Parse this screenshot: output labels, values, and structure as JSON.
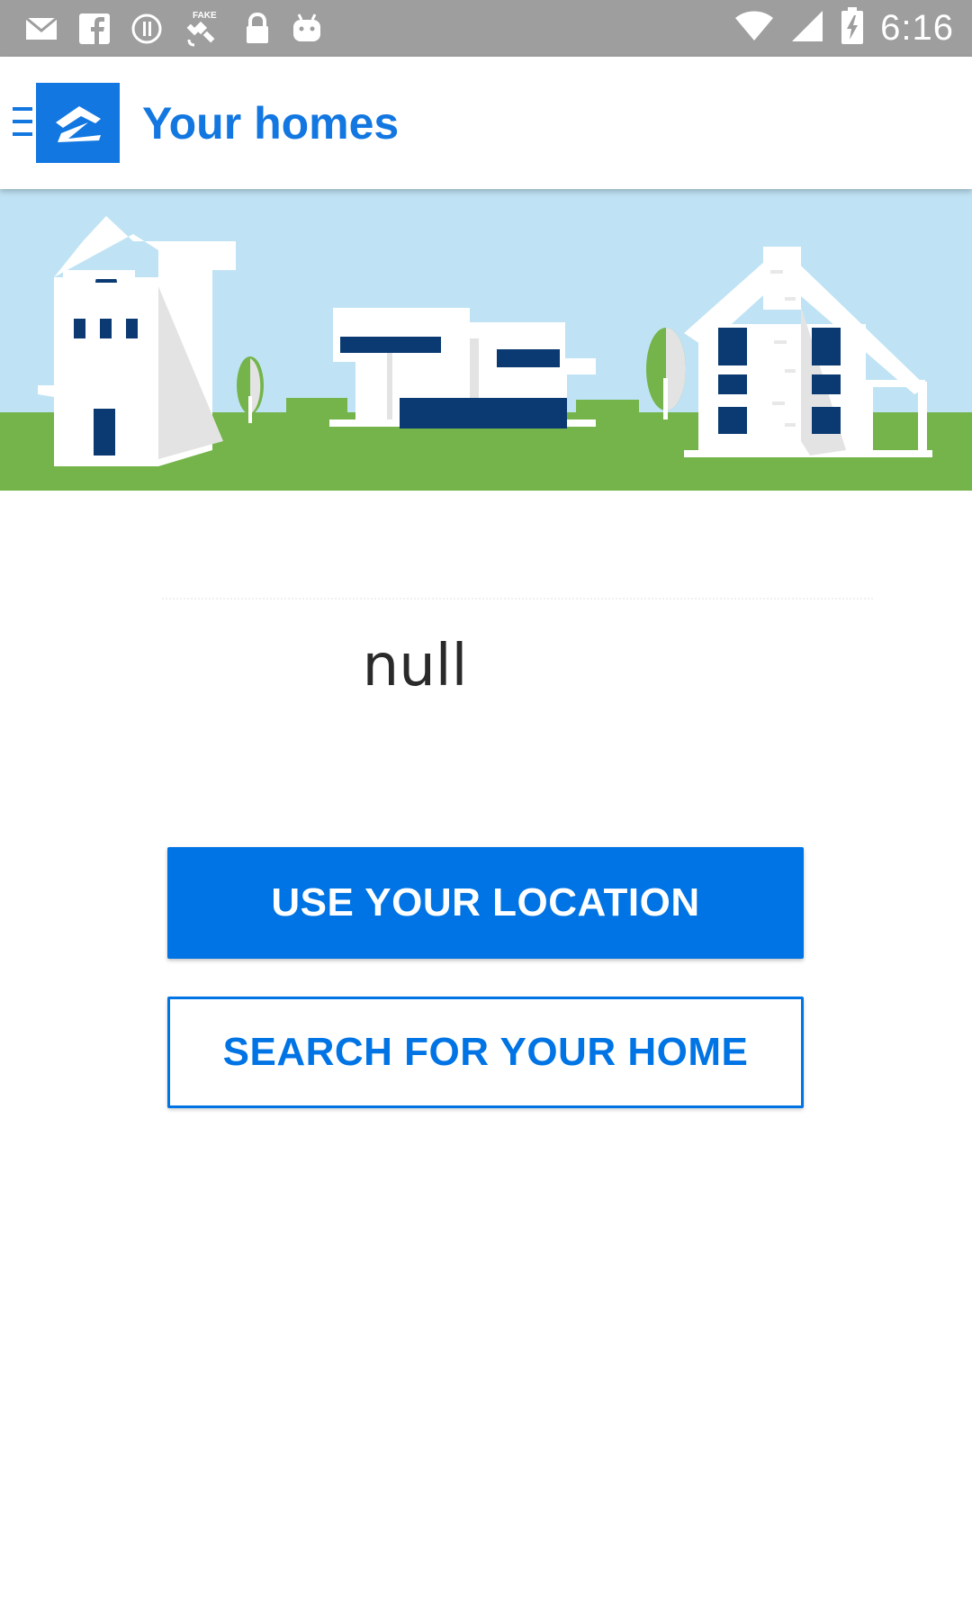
{
  "status_bar": {
    "time": "6:16",
    "left_icons": [
      "gmail-icon",
      "facebook-icon",
      "info-circle-icon",
      "fake-gps-icon",
      "lock-icon",
      "android-icon"
    ],
    "right_icons": [
      "wifi-icon",
      "signal-icon",
      "battery-charging-icon"
    ]
  },
  "app_bar": {
    "title": "Your homes",
    "brand_color": "#1277e1"
  },
  "main": {
    "address_text": "null",
    "use_location_label": "USE YOUR LOCATION",
    "search_home_label": "SEARCH FOR YOUR HOME"
  },
  "colors": {
    "primary": "#0074e4",
    "sky": "#bfe3f4",
    "grass": "#74b44a",
    "window": "#0b3a72"
  }
}
